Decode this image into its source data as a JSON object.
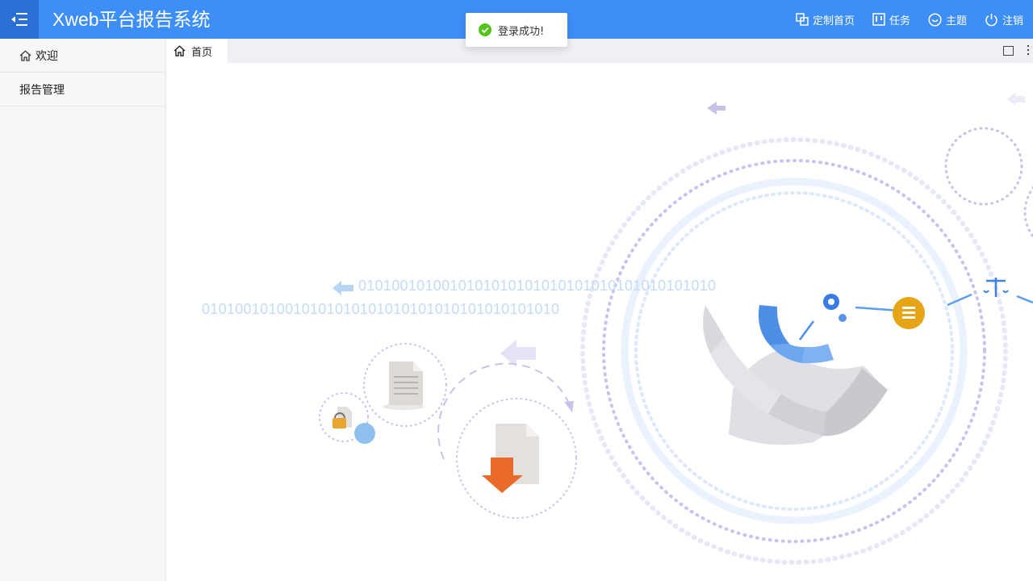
{
  "header": {
    "title": "Xweb平台报告系统",
    "actions": [
      {
        "label": "定制首页",
        "icon": "customize-icon"
      },
      {
        "label": "任务",
        "icon": "task-board-icon"
      },
      {
        "label": "主题",
        "icon": "smiley-icon"
      },
      {
        "label": "注销",
        "icon": "power-icon"
      }
    ]
  },
  "sidebar": {
    "items": [
      {
        "label": "欢迎",
        "icon": "home-icon"
      },
      {
        "label": "报告管理"
      }
    ]
  },
  "tabs": [
    {
      "label": "首页",
      "icon": "home-icon",
      "active": true
    }
  ],
  "content": {
    "binary_line_1": "0101001010010101010101010101010101010101010",
    "binary_line_2": "0101001010010101010101010101010101010101010"
  },
  "toast": {
    "message": "登录成功!",
    "icon": "check-circle-icon",
    "color": "#52c41a"
  },
  "colors": {
    "header": "#3e8ef7",
    "menu_toggle": "#2b6fd6",
    "sidebar": "#f7f7f7"
  }
}
